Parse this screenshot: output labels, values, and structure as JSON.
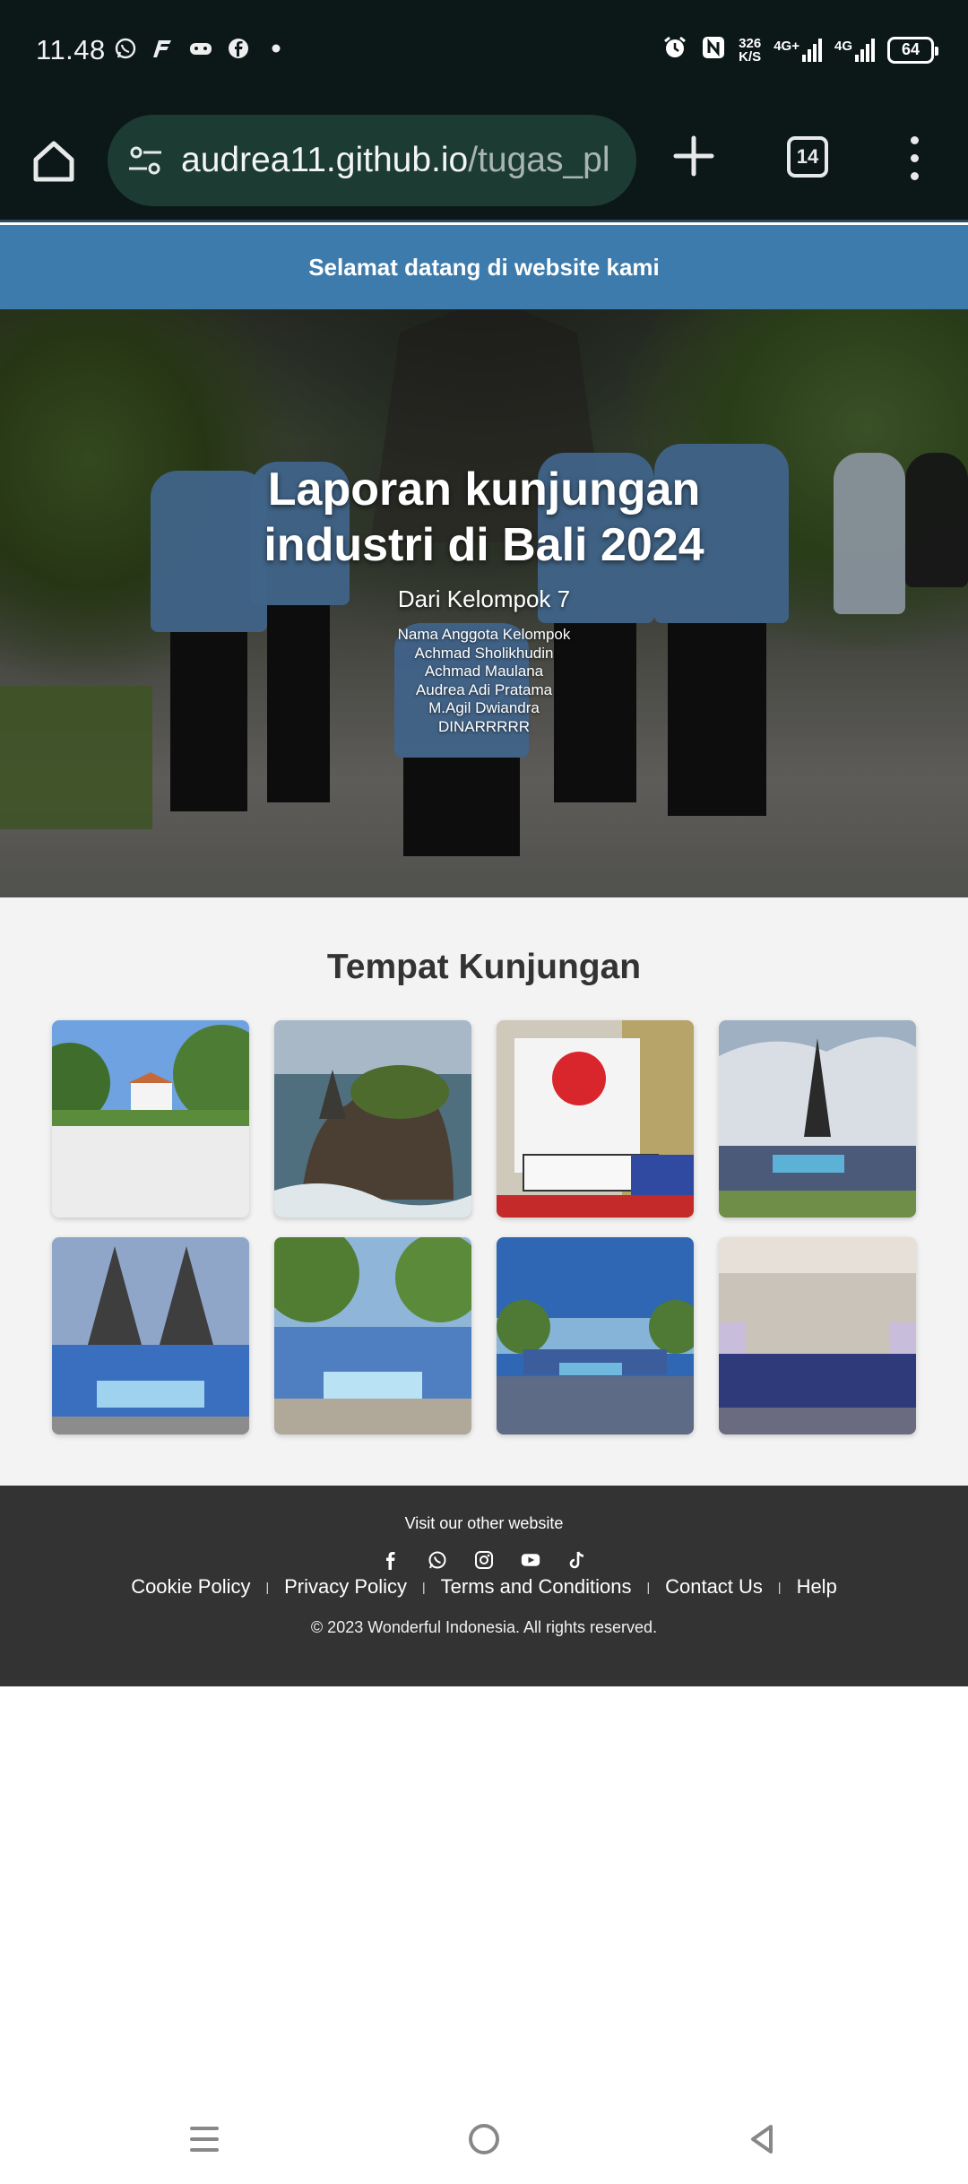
{
  "status_bar": {
    "time": "11.48",
    "left_icons": [
      "whatsapp-icon",
      "flash-app-icon",
      "game-controller-icon",
      "facebook-icon",
      "dot-icon"
    ],
    "net_speed_value": "326",
    "net_speed_unit": "K/S",
    "net_type_1": "4G+",
    "net_type_2": "4G",
    "battery": "64"
  },
  "browser": {
    "url_host": "audrea11.github.io",
    "url_path": "/tugas_pl",
    "tab_count": "14"
  },
  "page": {
    "welcome": "Selamat datang di website kami",
    "hero": {
      "title_line1": "Laporan kunjungan",
      "title_line2": "industri di Bali 2024",
      "subtitle": "Dari Kelompok 7",
      "members": [
        "Nama Anggota Kelompok",
        "Achmad Sholikhudin",
        "Achmad Maulana",
        "Audrea Adi Pratama",
        "M.Agil Dwiandra",
        "DINARRRRR"
      ]
    },
    "places": {
      "title": "Tempat Kunjungan"
    },
    "footer": {
      "visit": "Visit our other website",
      "social": [
        "facebook-icon",
        "whatsapp-icon",
        "instagram-icon",
        "youtube-icon",
        "tiktok-icon"
      ],
      "links": [
        "Cookie Policy",
        "Privacy Policy",
        "Terms and Conditions",
        "Contact Us",
        "Help"
      ],
      "copyright": "© 2023 Wonderful Indonesia. All rights reserved."
    }
  },
  "colors": {
    "status_bg": "#0c1717",
    "url_pill": "#1c3b33",
    "banner": "#3c7bac",
    "section_bg": "#f3f3f3",
    "footer_bg": "#333333"
  }
}
